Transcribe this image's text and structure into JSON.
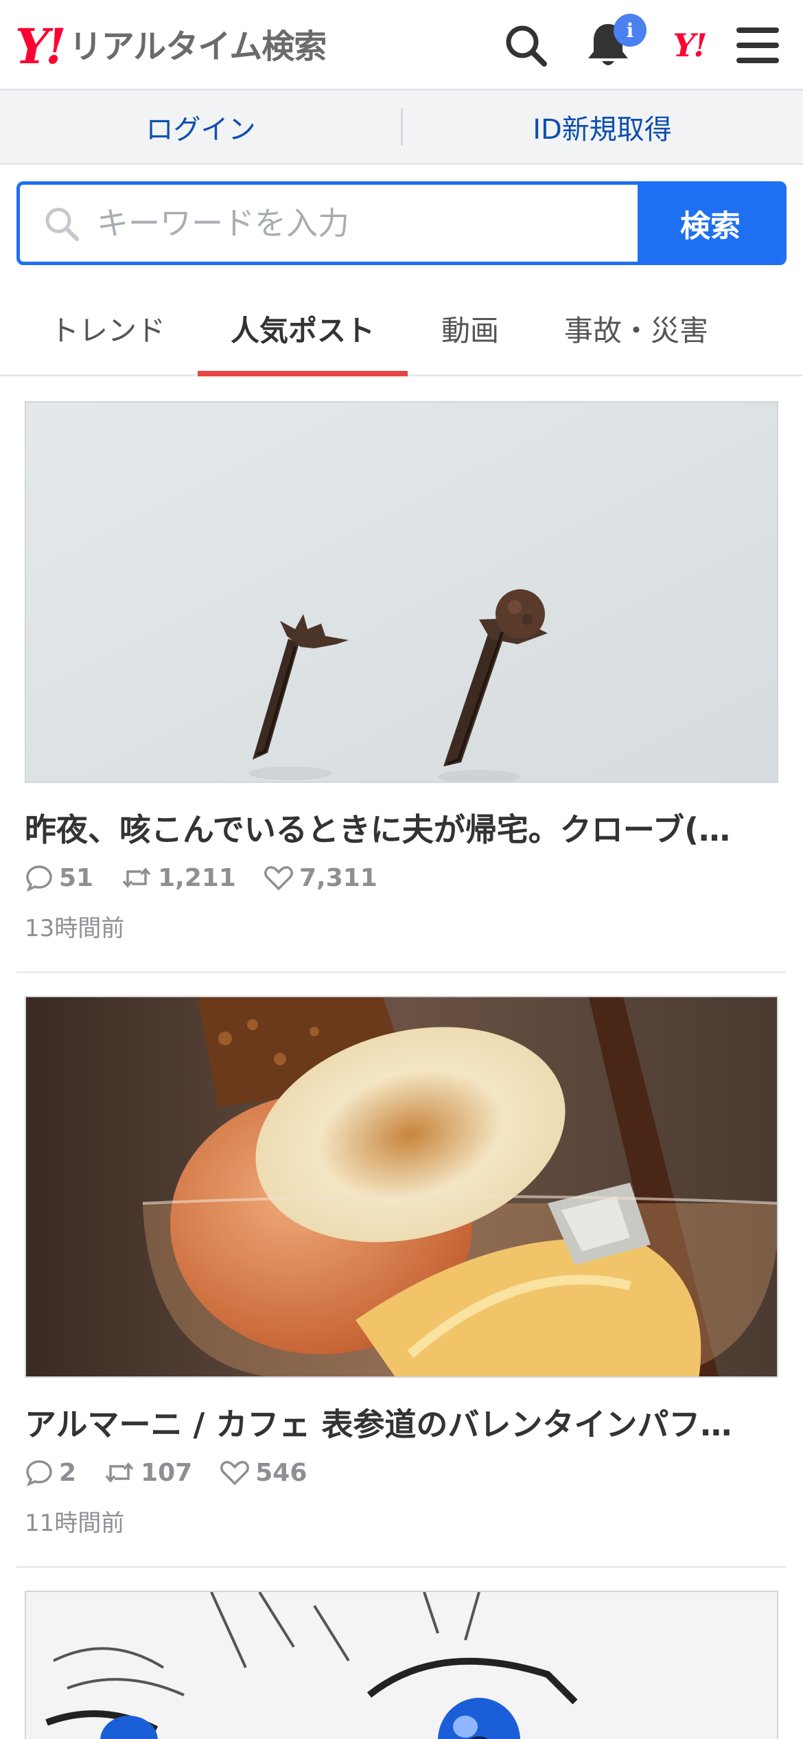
{
  "header": {
    "logo_mark": "Y!",
    "logo_text": "リアルタイム検索",
    "notification_badge": "i",
    "yahoo_mark": "Y!"
  },
  "auth": {
    "login_label": "ログイン",
    "signup_label": "ID新規取得"
  },
  "search": {
    "placeholder": "キーワードを入力",
    "value": "",
    "button_label": "検索"
  },
  "tabs": [
    {
      "label": "トレンド",
      "active": false
    },
    {
      "label": "人気ポスト",
      "active": true
    },
    {
      "label": "動画",
      "active": false
    },
    {
      "label": "事故・災害",
      "active": false
    }
  ],
  "posts": [
    {
      "title": "昨夜、咳こんでいるときに夫が帰宅。クローブ(…",
      "replies": "51",
      "reposts": "1,211",
      "likes": "7,311",
      "time": "13時間前",
      "thumbnail": "two-cloves-photo"
    },
    {
      "title": "アルマーニ / カフェ 表参道のバレンタインパフ…",
      "replies": "2",
      "reposts": "107",
      "likes": "546",
      "time": "11時間前",
      "thumbnail": "parfait-photo"
    },
    {
      "thumbnail": "anime-eyes-illustration"
    }
  ],
  "colors": {
    "brand_red": "#ff0033",
    "accent_blue": "#1e6ff1",
    "link_blue": "#0d4fae",
    "active_tab_underline": "#e64545",
    "badge_blue": "#4a80f0"
  }
}
